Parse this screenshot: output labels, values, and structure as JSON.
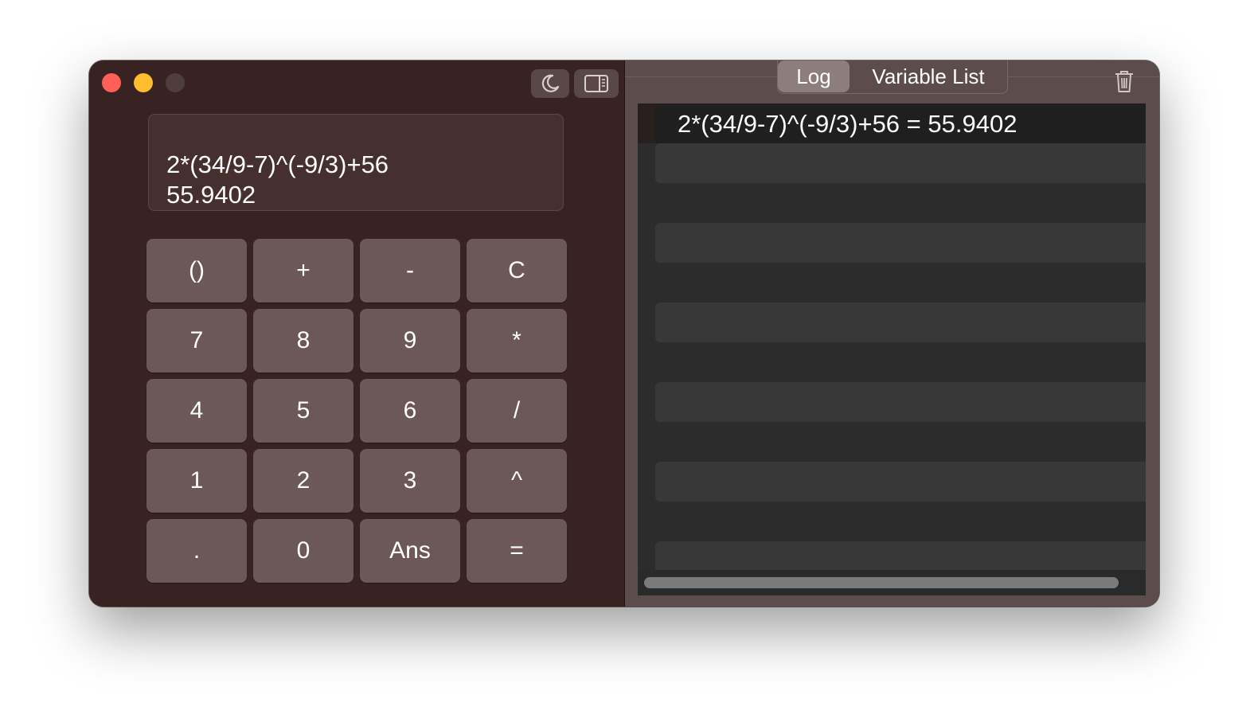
{
  "calculator": {
    "display": {
      "expression": "2*(34/9-7)^(-9/3)+56",
      "result": "55.9402"
    },
    "toolbar": {
      "theme_icon": "moon-icon",
      "sidebar_icon": "sidebar-right-icon"
    },
    "keys": [
      {
        "label": "()",
        "name": "parentheses-key"
      },
      {
        "label": "+",
        "name": "plus-key"
      },
      {
        "label": "-",
        "name": "minus-key"
      },
      {
        "label": "C",
        "name": "clear-key"
      },
      {
        "label": "7",
        "name": "seven-key"
      },
      {
        "label": "8",
        "name": "eight-key"
      },
      {
        "label": "9",
        "name": "nine-key"
      },
      {
        "label": "*",
        "name": "multiply-key"
      },
      {
        "label": "4",
        "name": "four-key"
      },
      {
        "label": "5",
        "name": "five-key"
      },
      {
        "label": "6",
        "name": "six-key"
      },
      {
        "label": "/",
        "name": "divide-key"
      },
      {
        "label": "1",
        "name": "one-key"
      },
      {
        "label": "2",
        "name": "two-key"
      },
      {
        "label": "3",
        "name": "three-key"
      },
      {
        "label": "^",
        "name": "power-key"
      },
      {
        "label": ".",
        "name": "decimal-key"
      },
      {
        "label": "0",
        "name": "zero-key"
      },
      {
        "label": "Ans",
        "name": "ans-key"
      },
      {
        "label": "=",
        "name": "equals-key"
      }
    ]
  },
  "sidebar": {
    "tabs": [
      {
        "label": "Log",
        "active": true
      },
      {
        "label": "Variable List",
        "active": false
      }
    ],
    "trash_icon": "trash-icon",
    "log_entries": [
      "2*(34/9-7)^(-9/3)+56 = 55.9402"
    ]
  },
  "colors": {
    "close": "#fe5f57",
    "minimize": "#febc2e",
    "zoom_inactive": "#4e3d3b",
    "key_background": "#6b5857",
    "window_background": "#382322"
  }
}
